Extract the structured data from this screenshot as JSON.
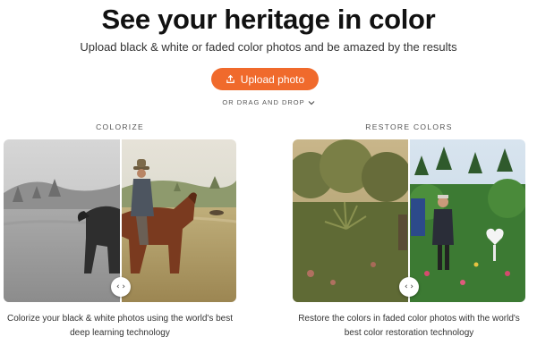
{
  "hero": {
    "title": "See your heritage in color",
    "subtitle": "Upload black & white or faded color photos and be amazed by the results"
  },
  "upload": {
    "label": "Upload photo",
    "icon": "upload-icon",
    "color": "#f06a2c"
  },
  "drag_drop": {
    "label": "OR DRAG AND DROP",
    "icon": "chevron-down-icon"
  },
  "sections": [
    {
      "label": "COLORIZE",
      "caption_line1": "Colorize your black & white photos using the world's best",
      "caption_line2": "deep learning technology",
      "handle_glyph": "‹ ›"
    },
    {
      "label": "RESTORE COLORS",
      "caption_line1": "Restore the colors in faded color photos with the world's",
      "caption_line2": "best color restoration technology",
      "handle_glyph": "‹ ›"
    }
  ]
}
